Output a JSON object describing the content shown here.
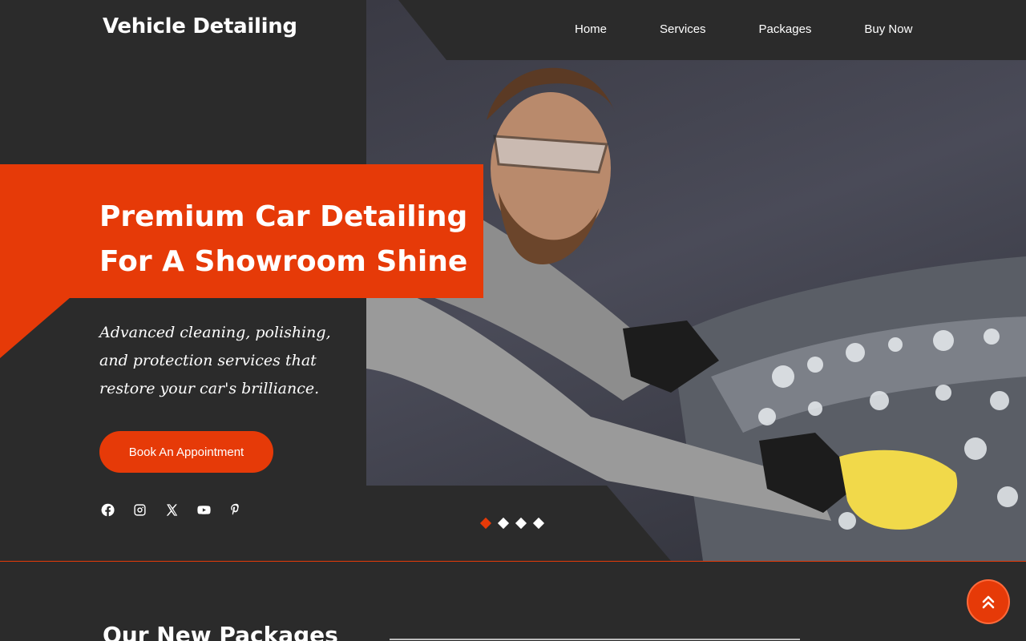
{
  "brand": {
    "name": "Vehicle Detailing",
    "accent": "#e63a08",
    "background": "#2b2b2b"
  },
  "nav": {
    "items": [
      {
        "label": "Home"
      },
      {
        "label": "Services"
      },
      {
        "label": "Packages"
      },
      {
        "label": "Buy Now"
      }
    ]
  },
  "hero": {
    "headline": "Premium Car Detailing For A Showroom Shine",
    "subtitle": "Advanced cleaning, polishing, and protection services that restore your car's brilliance.",
    "cta_label": "Book An Appointment",
    "slider": {
      "total": 4,
      "active_index": 0
    }
  },
  "socials": [
    "facebook-icon",
    "instagram-icon",
    "x-twitter-icon",
    "youtube-icon",
    "pinterest-icon"
  ],
  "packages_section": {
    "title": "Our New Packages"
  },
  "back_to_top": {
    "icon": "double-chevron-up-icon"
  }
}
